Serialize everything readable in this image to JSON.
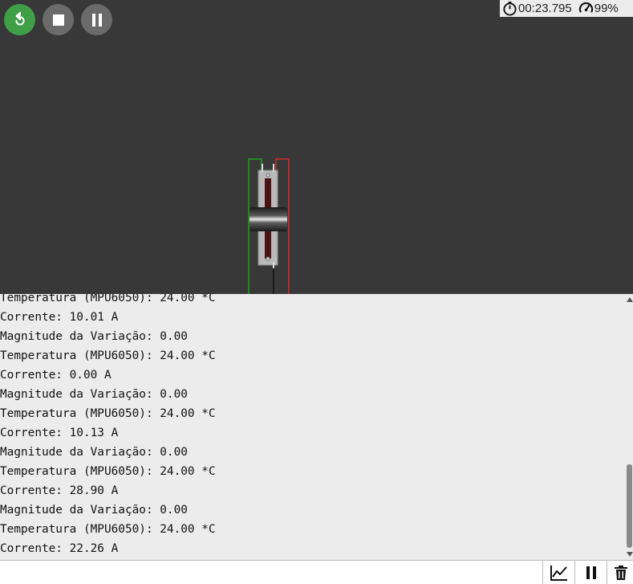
{
  "toolbar": {
    "restart_icon": "restart-icon",
    "stop_icon": "stop-icon",
    "pause_icon": "pause-icon"
  },
  "status": {
    "timer": "00:23.795",
    "speed": "99%",
    "timer_icon": "stopwatch-icon",
    "speed_icon": "speedometer-icon"
  },
  "colors": {
    "canvas_bg": "#383838",
    "restart_green": "#3f9f47",
    "wire_green": "#1fa01f",
    "wire_red": "#d42a2a",
    "serial_bg": "#ececec"
  },
  "serial": {
    "lines": [
      "Temperatura (MPU6050): 24.00 *C",
      "Corrente: 10.01 A",
      "Magnitude da Variação: 0.00",
      "Temperatura (MPU6050): 24.00 *C",
      "Corrente: 0.00 A",
      "Magnitude da Variação: 0.00",
      "Temperatura (MPU6050): 24.00 *C",
      "Corrente: 10.13 A",
      "Magnitude da Variação: 0.00",
      "Temperatura (MPU6050): 24.00 *C",
      "Corrente: 28.90 A",
      "Magnitude da Variação: 0.00",
      "Temperatura (MPU6050): 24.00 *C",
      "Corrente: 22.26 A"
    ],
    "input_value": ""
  },
  "serial_tools": {
    "plotter_icon": "chart-line-icon",
    "pause_icon": "pause-icon",
    "clear_icon": "trash-icon"
  }
}
